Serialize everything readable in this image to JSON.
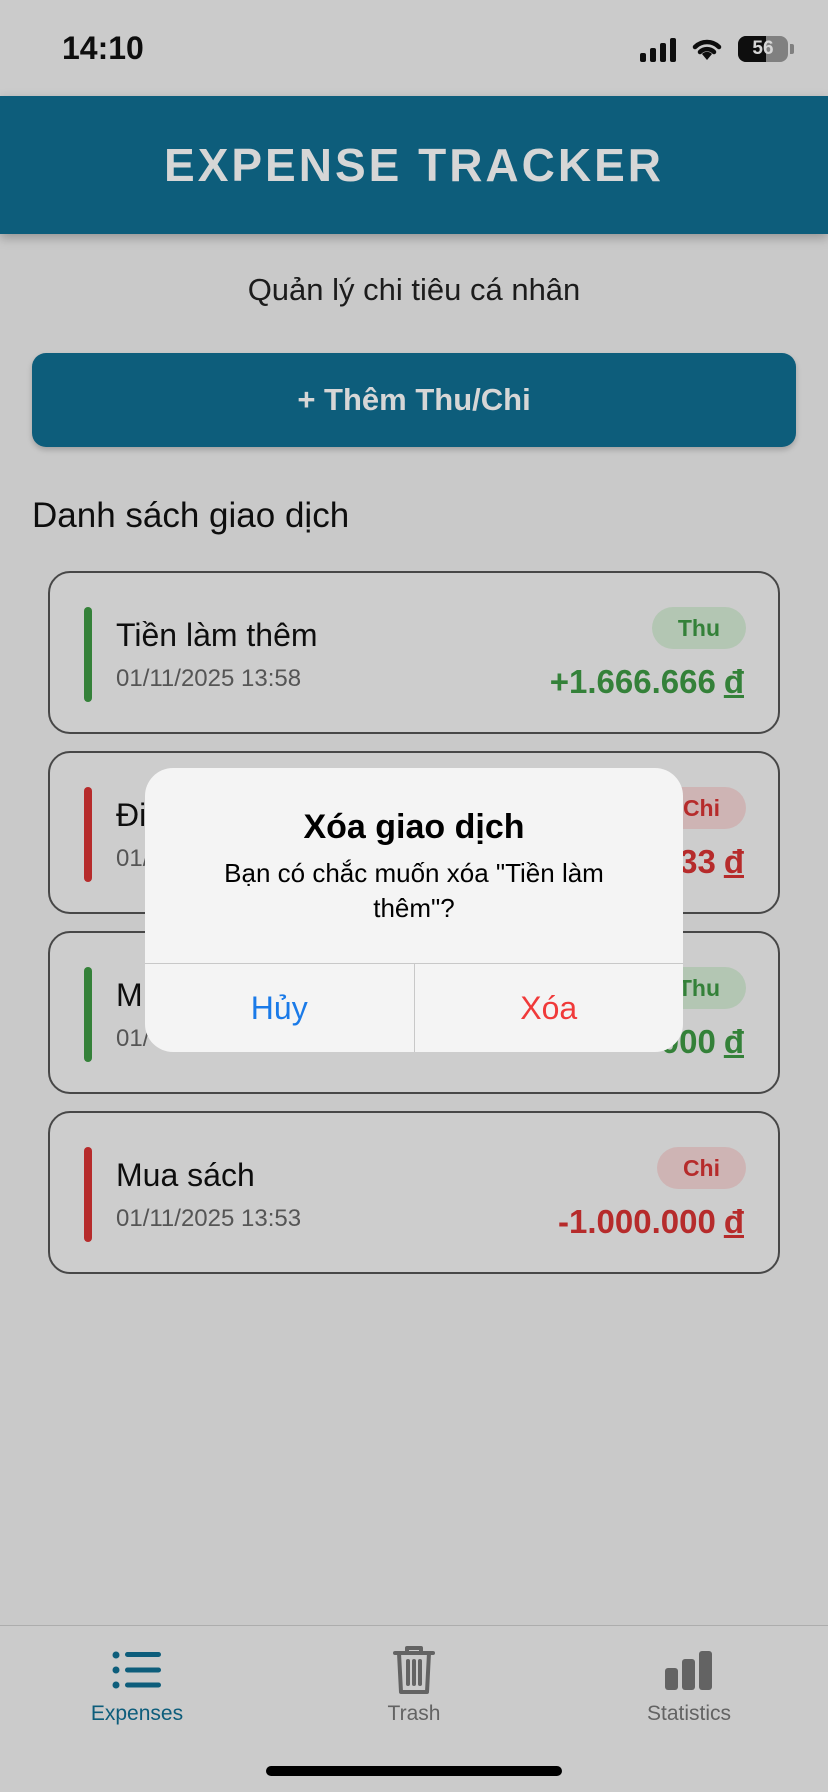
{
  "status": {
    "time": "14:10",
    "battery": "56",
    "battery_level": 0.56
  },
  "header": {
    "title": "EXPENSE TRACKER"
  },
  "subtitle": "Quản lý chi tiêu cá nhân",
  "add_button": {
    "label": "+ Thêm Thu/Chi"
  },
  "section_title": "Danh sách giao dịch",
  "currency_symbol": "đ",
  "transactions": [
    {
      "name": "Tiền làm thêm",
      "date": "01/11/2025 13:58",
      "badge": "Thu",
      "amount": "+1.666.666"
    },
    {
      "name": "Đi",
      "date": "01/",
      "badge": "Chi",
      "amount": "33"
    },
    {
      "name": "M",
      "date": "01/",
      "badge": "Thu",
      "amount": "000"
    },
    {
      "name": "Mua sách",
      "date": "01/11/2025 13:53",
      "badge": "Chi",
      "amount": "-1.000.000"
    }
  ],
  "dialog": {
    "title": "Xóa giao dịch",
    "message": "Bạn có chắc muốn xóa \"Tiền làm thêm\"?",
    "cancel_label": "Hủy",
    "confirm_label": "Xóa"
  },
  "tabs": [
    {
      "label": "Expenses",
      "icon": "list-icon",
      "active": true
    },
    {
      "label": "Trash",
      "icon": "trash-icon",
      "active": false
    },
    {
      "label": "Statistics",
      "icon": "bar-chart-icon",
      "active": false
    }
  ],
  "colors": {
    "primary": "#106f93",
    "income": "#3f9a44",
    "income_bg": "#d6ecd6",
    "expense": "#d93434",
    "expense_bg": "#f6d7d7",
    "ios_blue": "#1a7ae8",
    "ios_red": "#f03a3a",
    "tab_inactive": "#777777"
  }
}
